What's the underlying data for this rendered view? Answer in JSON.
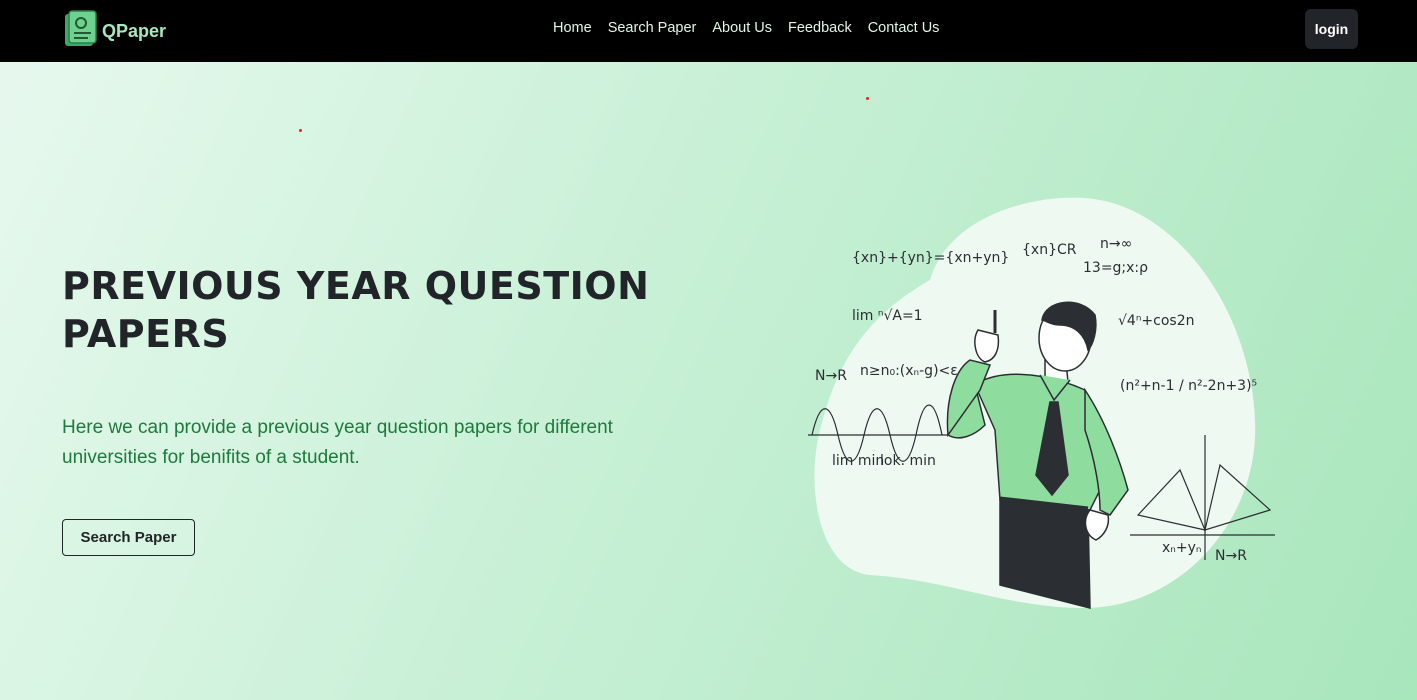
{
  "brand": {
    "name": "QPaper",
    "icon": "book-icon"
  },
  "nav": {
    "links": [
      "Home",
      "Search Paper",
      "About Us",
      "Feedback",
      "Contact Us"
    ],
    "login_label": "login"
  },
  "hero": {
    "title": "PREVIOUS YEAR QUESTION PAPERS",
    "description": "Here we can provide a previous year question papers for different universities for benifits of a student.",
    "button_label": "Search Paper"
  },
  "illustration": {
    "name": "teacher-math-illustration",
    "formulas": [
      "{xn}+{yn}={xn+yn}",
      "{xn}CR",
      "n→∞",
      "13=g;x:ρ",
      "lim ⁿ√A=1",
      "N→R",
      "n≥n₀:(xₙ-g)<ε",
      "√4ⁿ+cos2n",
      "(n²+n-1 / n²-2n+3)⁵",
      "lim min",
      "lok. min",
      "xₙ+yₙ",
      "N→R"
    ]
  },
  "colors": {
    "accent": "#a7e8bd",
    "nav_bg": "#000000",
    "text_green": "#1e7a3c",
    "dark": "#212529"
  }
}
